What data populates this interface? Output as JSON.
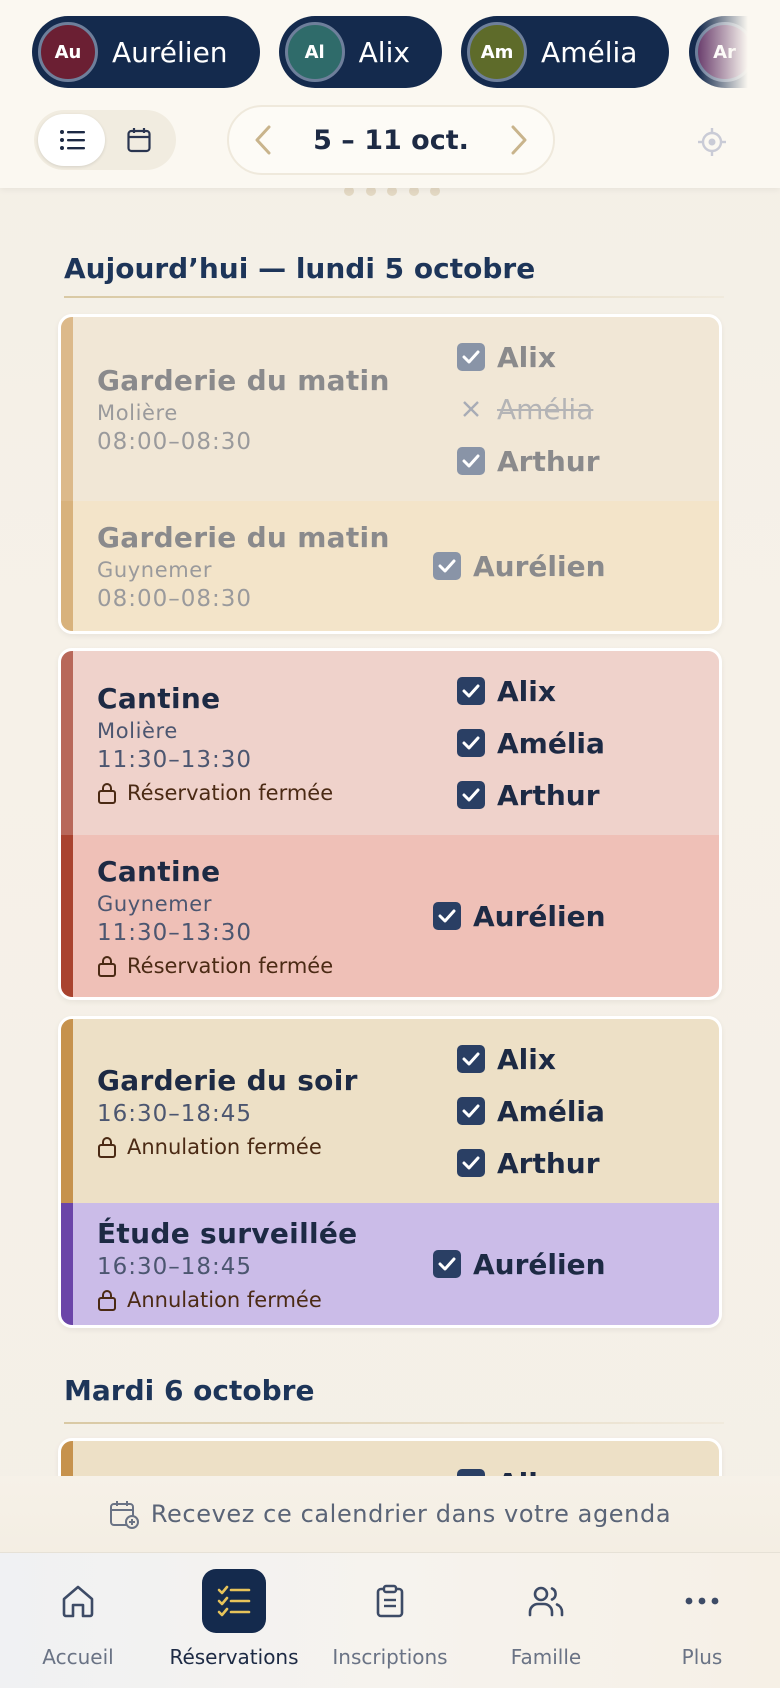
{
  "children": [
    {
      "initials": "Au",
      "name": "Aurélien",
      "color": "#6b1f33"
    },
    {
      "initials": "Al",
      "name": "Alix",
      "color": "#2f6b6a"
    },
    {
      "initials": "Am",
      "name": "Amélia",
      "color": "#5e6b2a"
    },
    {
      "initials": "Ar",
      "name": "",
      "color": "#6b3f6e"
    }
  ],
  "week": {
    "label": "5 – 11 oct."
  },
  "days": [
    {
      "title": "Aujourd’hui — lundi 5 octobre",
      "groups": [
        {
          "entries": [
            {
              "title": "Garderie du matin",
              "school": "Molière",
              "time": "08:00–08:30",
              "lock": "",
              "kids": [
                {
                  "name": "Alix",
                  "state": "checked"
                },
                {
                  "name": "Amélia",
                  "state": "cancelled"
                },
                {
                  "name": "Arthur",
                  "state": "checked"
                }
              ]
            },
            {
              "title": "Garderie du matin",
              "school": "Guynemer",
              "time": "08:00–08:30",
              "lock": "",
              "kids": [
                {
                  "name": "Aurélien",
                  "state": "checked"
                }
              ]
            }
          ]
        },
        {
          "entries": [
            {
              "title": "Cantine",
              "school": "Molière",
              "time": "11:30–13:30",
              "lock": "Réservation fermée",
              "kids": [
                {
                  "name": "Alix",
                  "state": "checked"
                },
                {
                  "name": "Amélia",
                  "state": "checked"
                },
                {
                  "name": "Arthur",
                  "state": "checked"
                }
              ]
            },
            {
              "title": "Cantine",
              "school": "Guynemer",
              "time": "11:30–13:30",
              "lock": "Réservation fermée",
              "kids": [
                {
                  "name": "Aurélien",
                  "state": "checked"
                }
              ]
            }
          ]
        },
        {
          "entries": [
            {
              "title": "Garderie du soir",
              "school": "",
              "time": "16:30–18:45",
              "lock": "Annulation fermée",
              "kids": [
                {
                  "name": "Alix",
                  "state": "checked"
                },
                {
                  "name": "Amélia",
                  "state": "checked"
                },
                {
                  "name": "Arthur",
                  "state": "checked"
                }
              ]
            },
            {
              "title": "Étude surveillée",
              "school": "",
              "time": "16:30–18:45",
              "lock": "Annulation fermée",
              "kids": [
                {
                  "name": "Aurélien",
                  "state": "checked"
                }
              ]
            }
          ]
        }
      ]
    },
    {
      "title": "Mardi 6 octobre",
      "groups": [
        {
          "entries": [
            {
              "title": "",
              "school": "",
              "time": "",
              "lock": "",
              "kids": [
                {
                  "name": "Alix",
                  "state": "checked"
                }
              ]
            }
          ]
        }
      ]
    }
  ],
  "subscribe": {
    "label": "Recevez ce calendrier dans votre agenda"
  },
  "nav": [
    {
      "label": "Accueil",
      "icon": "home-icon"
    },
    {
      "label": "Réservations",
      "icon": "checklist-icon"
    },
    {
      "label": "Inscriptions",
      "icon": "clipboard-icon"
    },
    {
      "label": "Famille",
      "icon": "users-icon"
    },
    {
      "label": "Plus",
      "icon": "more-icon"
    }
  ],
  "colors": {
    "navy": "#142a4d",
    "morning": "#f1e7d6",
    "lunch_a": "#efd2cb",
    "lunch_b": "#efc0b7",
    "evening": "#ede0c6",
    "study": "#cbbce8"
  }
}
